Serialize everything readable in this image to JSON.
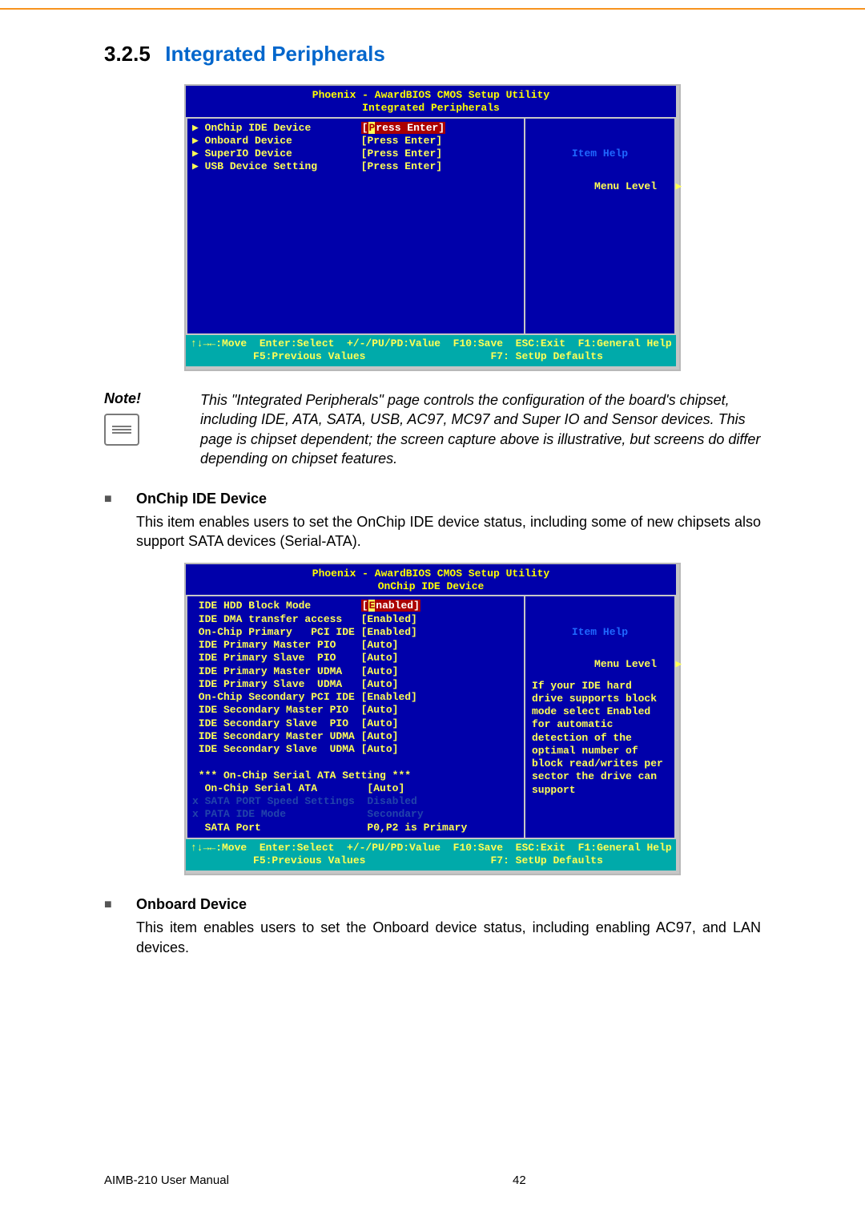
{
  "section": {
    "number": "3.2.5",
    "title": "Integrated Peripherals"
  },
  "bios1": {
    "title_line1": "Phoenix - AwardBIOS CMOS Setup Utility",
    "title_line2": "Integrated Peripherals",
    "rows": [
      {
        "marker": "▶",
        "label": "OnChip IDE Device",
        "value": "[Press Enter]",
        "selected": true
      },
      {
        "marker": "▶",
        "label": "Onboard Device",
        "value": "[Press Enter]",
        "selected": false
      },
      {
        "marker": "▶",
        "label": "SuperIO Device",
        "value": "[Press Enter]",
        "selected": false
      },
      {
        "marker": "▶",
        "label": "USB Device Setting",
        "value": "[Press Enter]",
        "selected": false
      }
    ],
    "help_header": "Item Help",
    "menu_level_label": "Menu Level",
    "menu_level_marker": "▶",
    "footer_l1": "↑↓→←:Move  Enter:Select  +/-/PU/PD:Value  F10:Save  ESC:Exit  F1:General Help",
    "footer_l2": "          F5:Previous Values                    F7: SetUp Defaults"
  },
  "note": {
    "label": "Note!",
    "body": "This \"Integrated Peripherals\" page controls the configuration of the board's chipset, including IDE, ATA, SATA, USB, AC97, MC97 and Super IO and Sensor devices. This page is chipset dependent; the screen capture above is illustrative, but screens do differ depending on chipset features."
  },
  "sub1": {
    "heading": "OnChip IDE Device",
    "body": "This item enables users to set the OnChip IDE device status, including some of new chipsets also support SATA devices (Serial-ATA)."
  },
  "bios2": {
    "title_line1": "Phoenix - AwardBIOS CMOS Setup Utility",
    "title_line2": "OnChip IDE Device",
    "rows": [
      {
        "label": "IDE HDD Block Mode",
        "value": "[Enabled]",
        "selected": true,
        "dim": false
      },
      {
        "label": "IDE DMA transfer access",
        "value": "[Enabled]",
        "selected": false,
        "dim": false
      },
      {
        "label": "On-Chip Primary   PCI IDE",
        "value": "[Enabled]",
        "selected": false,
        "dim": false
      },
      {
        "label": "IDE Primary Master PIO",
        "value": "[Auto]",
        "selected": false,
        "dim": false
      },
      {
        "label": "IDE Primary Slave  PIO",
        "value": "[Auto]",
        "selected": false,
        "dim": false
      },
      {
        "label": "IDE Primary Master UDMA",
        "value": "[Auto]",
        "selected": false,
        "dim": false
      },
      {
        "label": "IDE Primary Slave  UDMA",
        "value": "[Auto]",
        "selected": false,
        "dim": false
      },
      {
        "label": "On-Chip Secondary PCI IDE",
        "value": "[Enabled]",
        "selected": false,
        "dim": false
      },
      {
        "label": "IDE Secondary Master PIO",
        "value": "[Auto]",
        "selected": false,
        "dim": false
      },
      {
        "label": "IDE Secondary Slave  PIO",
        "value": "[Auto]",
        "selected": false,
        "dim": false
      },
      {
        "label": "IDE Secondary Master UDMA",
        "value": "[Auto]",
        "selected": false,
        "dim": false
      },
      {
        "label": "IDE Secondary Slave  UDMA",
        "value": "[Auto]",
        "selected": false,
        "dim": false
      }
    ],
    "extra_header": "*** On-Chip Serial ATA Setting ***",
    "extra_rows": [
      {
        "prefix": " ",
        "label": "On-Chip Serial ATA",
        "value": "[Auto]",
        "dim": false
      },
      {
        "prefix": "x",
        "label": "SATA PORT Speed Settings",
        "value": "Disabled",
        "dim": true
      },
      {
        "prefix": "x",
        "label": "PATA IDE Mode",
        "value": "Secondary",
        "dim": true
      },
      {
        "prefix": " ",
        "label": "SATA Port",
        "value": "P0,P2 is Primary",
        "dim": false
      }
    ],
    "help_header": "Item Help",
    "menu_level_label": "Menu Level",
    "menu_level_marker": "▶",
    "help_body": "If your IDE hard drive supports block mode select Enabled for automatic detection of the optimal number of block read/writes per sector the drive can support",
    "footer_l1": "↑↓→←:Move  Enter:Select  +/-/PU/PD:Value  F10:Save  ESC:Exit  F1:General Help",
    "footer_l2": "          F5:Previous Values                    F7: SetUp Defaults"
  },
  "sub2": {
    "heading": "Onboard Device",
    "body": "This item enables users to set the Onboard device status, including enabling AC97, and LAN devices."
  },
  "footer": {
    "left": "AIMB-210 User Manual",
    "page": "42"
  }
}
